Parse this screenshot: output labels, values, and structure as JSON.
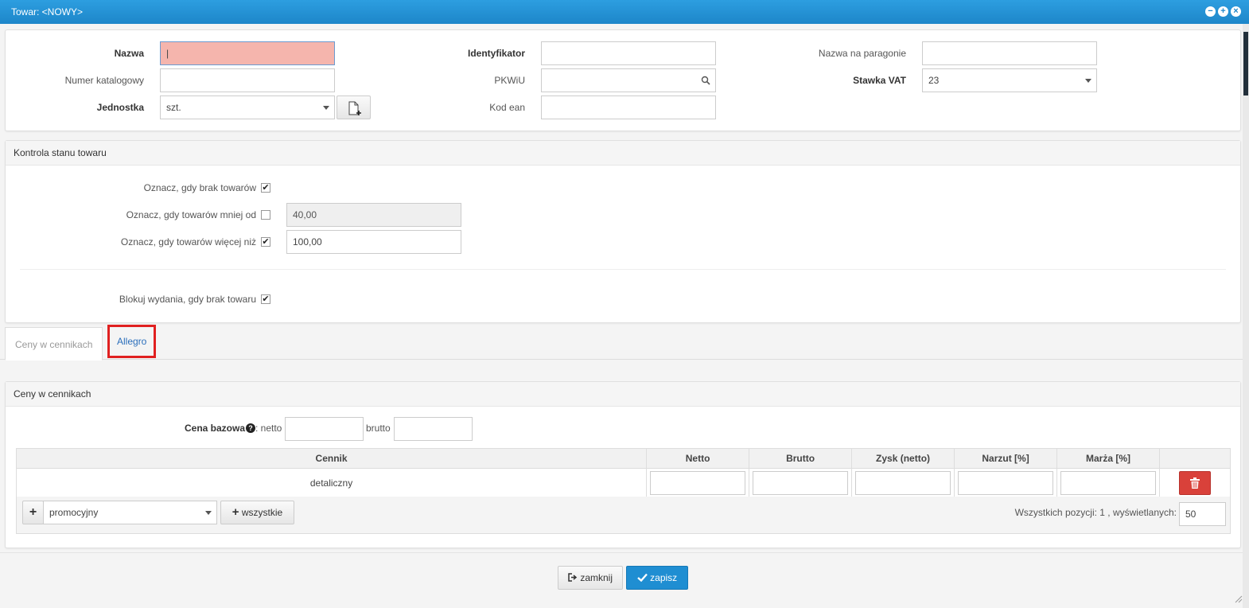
{
  "window": {
    "title": "Towar: <NOWY>",
    "controls": [
      "minimize-icon",
      "maximize-icon",
      "close-icon"
    ]
  },
  "general": {
    "name_label": "Nazwa",
    "name_value": "|",
    "catalog_label": "Numer katalogowy",
    "catalog_value": "",
    "unit_label": "Jednostka",
    "unit_value": "szt.",
    "identifier_label": "Identyfikator",
    "identifier_value": "",
    "pkwiu_label": "PKWiU",
    "pkwiu_value": "",
    "ean_label": "Kod ean",
    "ean_value": "",
    "receipt_name_label": "Nazwa na paragonie",
    "receipt_name_value": "",
    "vat_label": "Stawka VAT",
    "vat_value": "23"
  },
  "stock": {
    "header": "Kontrola stanu towaru",
    "mark_missing_label": "Oznacz, gdy brak towarów",
    "mark_missing_checked": true,
    "mark_less_label": "Oznacz, gdy towarów mniej od",
    "mark_less_checked": false,
    "mark_less_value": "40,00",
    "mark_more_label": "Oznacz, gdy towarów więcej niż",
    "mark_more_checked": true,
    "mark_more_value": "100,00",
    "block_label": "Blokuj wydania, gdy brak towaru",
    "block_checked": true
  },
  "tabs": [
    {
      "label": "Ceny w cennikach",
      "active": true
    },
    {
      "label": "Allegro",
      "active": false,
      "highlighted": true
    }
  ],
  "prices": {
    "header": "Ceny w cennikach",
    "base_price_label": "Cena bazowa",
    "netto_label": ": netto",
    "brutto_label": "brutto",
    "columns": [
      "Cennik",
      "Netto",
      "Brutto",
      "Zysk (netto)",
      "Narzut [%]",
      "Marża [%]"
    ],
    "rows": [
      {
        "cennik": "detaliczny"
      }
    ],
    "add_select_value": "promocyjny",
    "add_all_label": "wszystkie",
    "footer_text": "Wszystkich pozycji: 1 , wyświetlanych:",
    "page_size": "50"
  },
  "actions": {
    "close_label": "zamknij",
    "save_label": "zapisz"
  },
  "colors": {
    "titlebar": "#1d86c9",
    "primary_button": "#1f8ed2",
    "error_field": "#f5b5ad",
    "delete_button": "#d9413a",
    "highlight_box": "#e02020"
  }
}
